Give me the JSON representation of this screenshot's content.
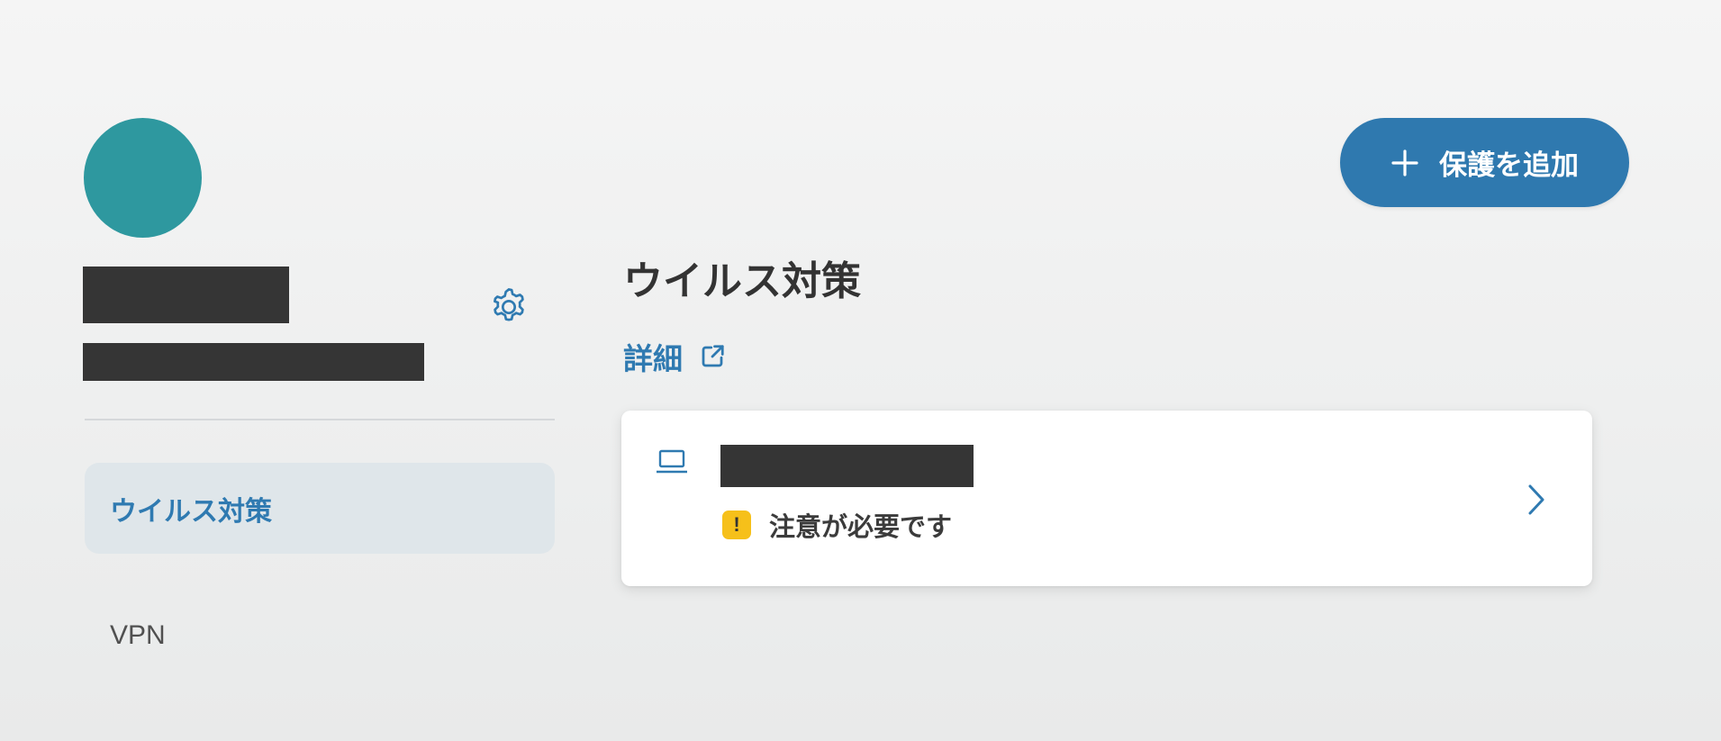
{
  "sidebar": {
    "nav_items": [
      {
        "label": "ウイルス対策",
        "active": true
      },
      {
        "label": "VPN",
        "active": false
      }
    ]
  },
  "header": {
    "add_button_label": "保護を追加"
  },
  "main": {
    "title": "ウイルス対策",
    "details_link_label": "詳細",
    "device": {
      "status_text": "注意が必要です",
      "warning_glyph": "!"
    }
  },
  "icons": {
    "avatar": "avatar-circle",
    "settings": "gear-icon",
    "add": "plus-icon",
    "external": "external-link-icon",
    "device": "laptop-icon",
    "warning": "warning-icon",
    "chevron": "chevron-right-icon"
  },
  "colors": {
    "accent": "#2f7ab1",
    "avatar": "#2e989f",
    "active_nav_bg": "#dfe6ea",
    "warning": "#f6c01a",
    "button_bg": "#2f79af"
  }
}
